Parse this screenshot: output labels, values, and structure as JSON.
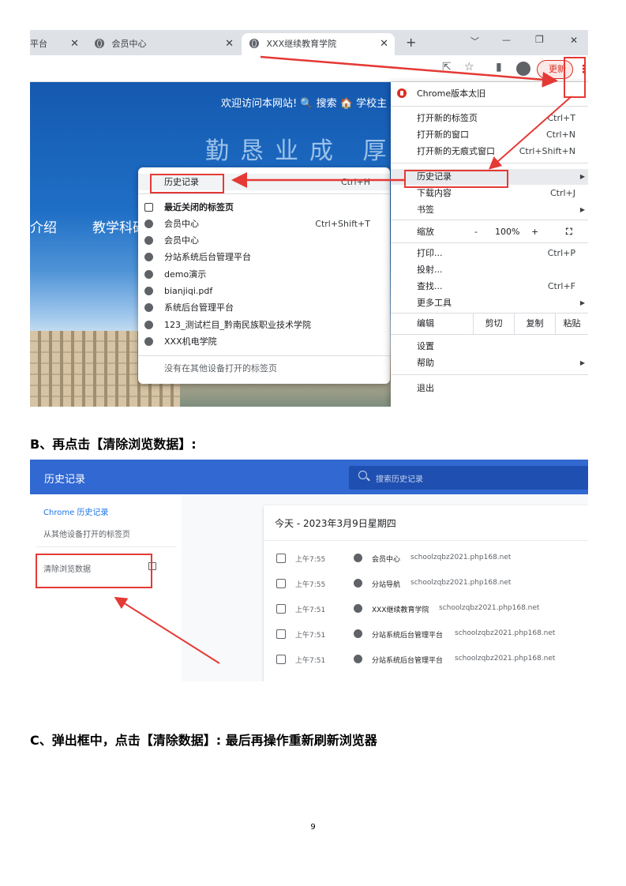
{
  "screenshot1": {
    "tabs": [
      {
        "label": "平台"
      },
      {
        "label": "会员中心"
      },
      {
        "label": "XXX继续教育学院"
      }
    ],
    "new_tab": "+",
    "window_controls": [
      "﹀",
      "—",
      "❐",
      "✕"
    ],
    "update_label": "更新",
    "site": {
      "top_links": "欢迎访问本网站! 🔍 搜索  🏠 学校主",
      "motto": "勤恳业成  厚↓",
      "nav_left": "介绍",
      "nav_item": "教学科研"
    },
    "history_menu": {
      "header": "历史记录",
      "header_shortcut": "Ctrl+H",
      "recent_closed": "最近关闭的标签页",
      "items": [
        {
          "label": "会员中心",
          "shortcut": "Ctrl+Shift+T"
        },
        {
          "label": "会员中心",
          "shortcut": ""
        },
        {
          "label": "分站系统后台管理平台",
          "shortcut": ""
        },
        {
          "label": "demo演示",
          "shortcut": ""
        },
        {
          "label": "bianjiqi.pdf",
          "shortcut": ""
        },
        {
          "label": "系统后台管理平台",
          "shortcut": ""
        },
        {
          "label": "123_测试栏目_黔南民族职业技术学院",
          "shortcut": ""
        },
        {
          "label": "XXX机电学院",
          "shortcut": ""
        }
      ],
      "other_devices": "没有在其他设备打开的标签页"
    },
    "chrome_menu": {
      "outdated": "Chrome版本太旧",
      "new_tab": "打开新的标签页",
      "new_tab_sc": "Ctrl+T",
      "new_window": "打开新的窗口",
      "new_window_sc": "Ctrl+N",
      "incognito": "打开新的无痕式窗口",
      "incognito_sc": "Ctrl+Shift+N",
      "history": "历史记录",
      "downloads": "下载内容",
      "downloads_sc": "Ctrl+J",
      "bookmarks": "书签",
      "zoom": "缩放",
      "zoom_minus": "-",
      "zoom_value": "100%",
      "zoom_plus": "+",
      "print": "打印...",
      "print_sc": "Ctrl+P",
      "cast": "投射...",
      "find": "查找...",
      "find_sc": "Ctrl+F",
      "more_tools": "更多工具",
      "edit": "编辑",
      "cut": "剪切",
      "copy": "复制",
      "paste": "粘贴",
      "settings": "设置",
      "help": "帮助",
      "exit": "退出"
    }
  },
  "caption_b": "B、再点击【清除浏览数据】:",
  "screenshot2": {
    "title": "历史记录",
    "search_placeholder": "搜索历史记录",
    "sidebar": {
      "chrome_history": "Chrome 历史记录",
      "other_devices": "从其他设备打开的标签页",
      "clear_data": "清除浏览数据"
    },
    "day_header": "今天 - 2023年3月9日星期四",
    "rows": [
      {
        "time": "上午7:55",
        "title": "会员中心",
        "domain": "schoolzqbz2021.php168.net"
      },
      {
        "time": "上午7:55",
        "title": "分站导航",
        "domain": "schoolzqbz2021.php168.net"
      },
      {
        "time": "上午7:51",
        "title": "XXX继续教育学院",
        "domain": "schoolzqbz2021.php168.net"
      },
      {
        "time": "上午7:51",
        "title": "分站系统后台管理平台",
        "domain": "schoolzqbz2021.php168.net"
      },
      {
        "time": "上午7:51",
        "title": "分站系统后台管理平台",
        "domain": "schoolzqbz2021.php168.net"
      }
    ]
  },
  "caption_c": "C、弹出框中，点击【清除数据】: 最后再操作重新刷新浏览器",
  "page_number": "9",
  "colors": {
    "annotation_red": "#e53935",
    "history_header_blue": "#3168d1"
  }
}
